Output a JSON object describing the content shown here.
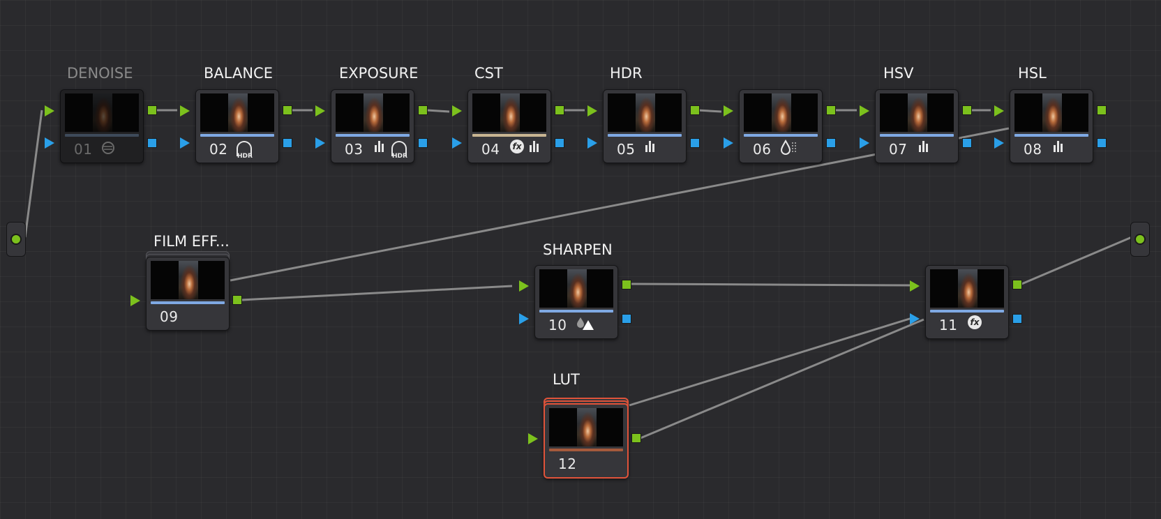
{
  "nodes": [
    {
      "id": "01",
      "label": "DENOISE",
      "icon": "noise-reduction-icon"
    },
    {
      "id": "02",
      "label": "BALANCE",
      "icon": "hdr-wheel-icon"
    },
    {
      "id": "03",
      "label": "EXPOSURE",
      "icon": "curves-hdr-icon"
    },
    {
      "id": "04",
      "label": "CST",
      "icon": "fx-bars-icon"
    },
    {
      "id": "05",
      "label": "HDR",
      "icon": "bars-icon"
    },
    {
      "id": "06",
      "label": "",
      "icon": "drop-icon"
    },
    {
      "id": "07",
      "label": "HSV",
      "icon": "bars-icon"
    },
    {
      "id": "08",
      "label": "HSL",
      "icon": "bars-icon"
    },
    {
      "id": "09",
      "label": "FILM EFF...",
      "icon": ""
    },
    {
      "id": "10",
      "label": "SHARPEN",
      "icon": "blur-sharpen-icon"
    },
    {
      "id": "11",
      "label": "",
      "icon": "fx-icon"
    },
    {
      "id": "12",
      "label": "LUT",
      "icon": ""
    }
  ],
  "icons": {
    "hdr_text": "HDR",
    "fx_text": "fx"
  },
  "colors": {
    "rgb_port": "#7cc11d",
    "alpha_port": "#2a9fe8",
    "selected_outline": "#e0533a"
  }
}
